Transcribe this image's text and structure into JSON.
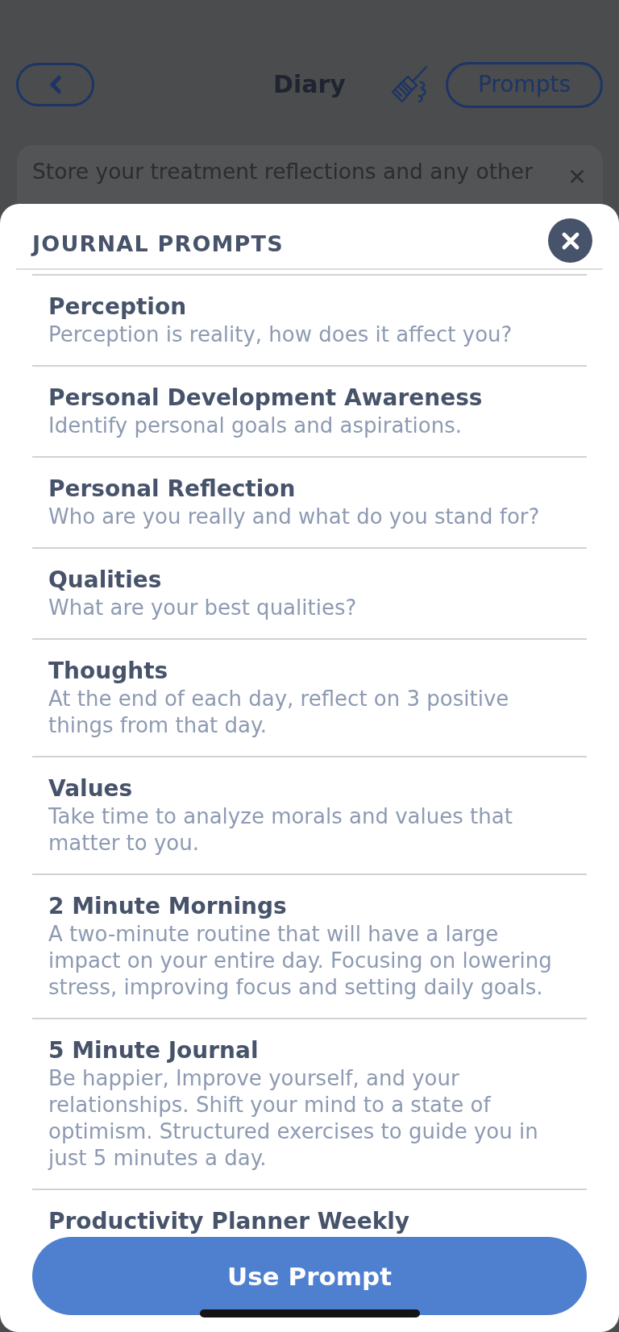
{
  "header": {
    "title": "Diary",
    "prompts_button": "Prompts"
  },
  "banner": {
    "text": "Store your treatment reflections and any other"
  },
  "sheet": {
    "title": "JOURNAL PROMPTS",
    "prompts": [
      {
        "title": "Perception",
        "description": "Perception is reality, how does it affect you?"
      },
      {
        "title": "Personal Development Awareness",
        "description": "Identify personal goals and aspirations."
      },
      {
        "title": "Personal Reflection",
        "description": "Who are you really and what do you stand for?"
      },
      {
        "title": "Qualities",
        "description": "What are your best qualities?"
      },
      {
        "title": "Thoughts",
        "description": "At the end of each day, reflect on 3 positive things from that day."
      },
      {
        "title": "Values",
        "description": "Take time to analyze morals and values that matter to you."
      },
      {
        "title": "2 Minute Mornings",
        "description": "A two-minute routine that will have a large impact on your entire day. Focusing on lowering stress, improving focus and setting daily goals."
      },
      {
        "title": "5 Minute Journal",
        "description": "Be happier, Improve yourself, and your relationships. Shift your mind to a state of optimism. Structured exercises to guide you in just 5 minutes a day."
      },
      {
        "title": "Productivity Planner Weekly"
      }
    ],
    "use_button": "Use Prompt"
  }
}
